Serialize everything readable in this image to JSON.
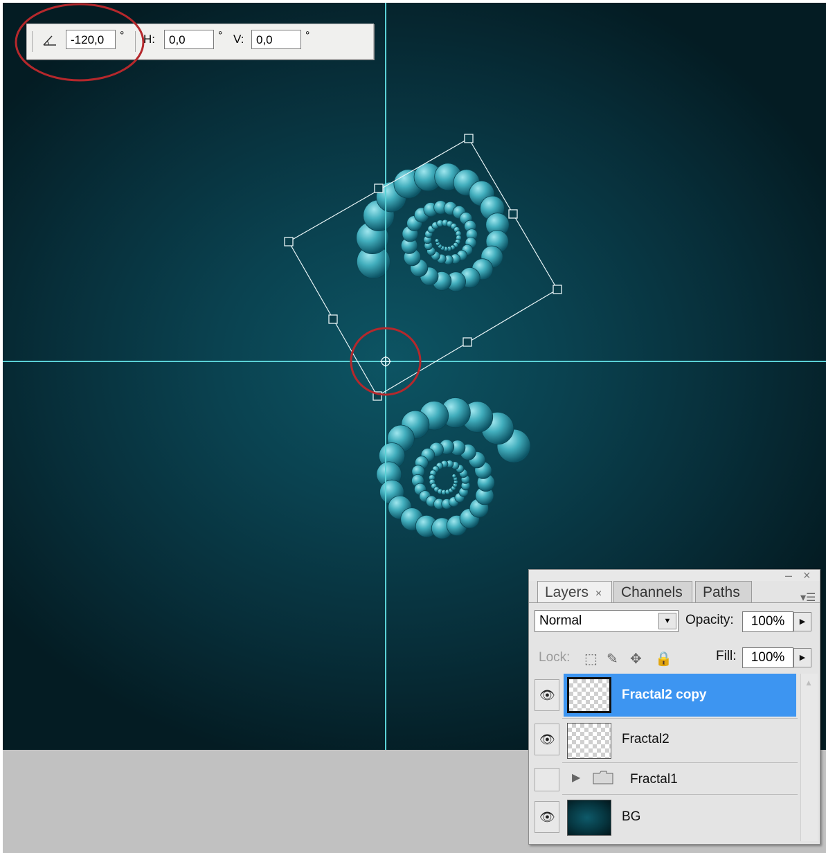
{
  "options_bar": {
    "angle_icon": "rotate-angle-icon",
    "angle_value": "-120,0",
    "degree_symbol": "°",
    "h_label": "H:",
    "h_value": "0,0",
    "v_label": "V:",
    "v_value": "0,0"
  },
  "canvas": {
    "guide_color": "#5ad1d6",
    "annotation_color": "#b5282c",
    "background_color": "#0a4250"
  },
  "layers_panel": {
    "tabs": [
      {
        "label": "Layers",
        "close": "×"
      },
      {
        "label": "Channels"
      },
      {
        "label": "Paths"
      }
    ],
    "minimize": "–",
    "close": "×",
    "menu_icon": "panel-menu-icon",
    "blend_mode": "Normal",
    "opacity_label": "Opacity:",
    "opacity_value": "100%",
    "lock_label": "Lock:",
    "fill_label": "Fill:",
    "fill_value": "100%",
    "layers": [
      {
        "name": "Fractal2 copy",
        "visible": true,
        "selected": true
      },
      {
        "name": "Fractal2",
        "visible": true,
        "selected": false
      },
      {
        "name": "Fractal1",
        "visible": false,
        "selected": false,
        "group": true
      },
      {
        "name": "BG",
        "visible": true,
        "selected": false
      }
    ]
  }
}
